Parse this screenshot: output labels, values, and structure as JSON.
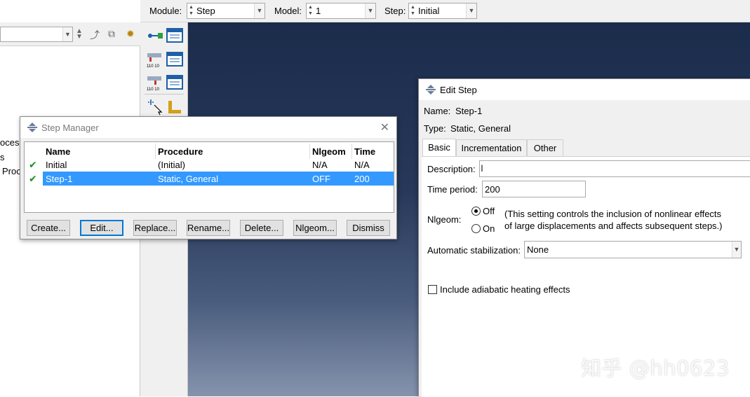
{
  "context_bar": {
    "module_label": "Module:",
    "module_value": "Step",
    "model_label": "Model:",
    "model_value": "1",
    "step_label": "Step:",
    "step_value": "Initial"
  },
  "model_tree": {
    "fragments": [
      "ocess",
      "s",
      "Proc"
    ]
  },
  "step_manager": {
    "title": "Step Manager",
    "columns": [
      "Name",
      "Procedure",
      "Nlgeom",
      "Time"
    ],
    "rows": [
      {
        "name": "Initial",
        "procedure": "(Initial)",
        "nlgeom": "N/A",
        "time": "N/A",
        "selected": false
      },
      {
        "name": "Step-1",
        "procedure": "Static, General",
        "nlgeom": "OFF",
        "time": "200",
        "selected": true
      }
    ],
    "buttons": {
      "create": "Create...",
      "edit": "Edit...",
      "replace": "Replace...",
      "rename": "Rename...",
      "delete": "Delete...",
      "nlgeom": "Nlgeom...",
      "dismiss": "Dismiss"
    }
  },
  "edit_step": {
    "title": "Edit Step",
    "name_label": "Name:",
    "name_value": "Step-1",
    "type_label": "Type:",
    "type_value": "Static, General",
    "tabs": [
      "Basic",
      "Incrementation",
      "Other"
    ],
    "active_tab": "Basic",
    "description_label": "Description:",
    "description_value": "",
    "time_period_label": "Time period:",
    "time_period_value": "200",
    "nlgeom_label": "Nlgeom:",
    "nlgeom_off": "Off",
    "nlgeom_on": "On",
    "nlgeom_selected": "Off",
    "nlgeom_note_line1": "(This setting controls the inclusion of nonlinear effects",
    "nlgeom_note_line2": "of large displacements and affects subsequent steps.)",
    "stabilization_label": "Automatic stabilization:",
    "stabilization_value": "None",
    "adiabatic_label": "Include adiabatic heating effects",
    "adiabatic_checked": false
  },
  "watermark": "知乎 @hh0623",
  "colors": {
    "selection": "#3399ff",
    "check_green": "#1e8f1e",
    "viewport_top": "#1b2c4b",
    "viewport_bottom": "#8593ad"
  }
}
